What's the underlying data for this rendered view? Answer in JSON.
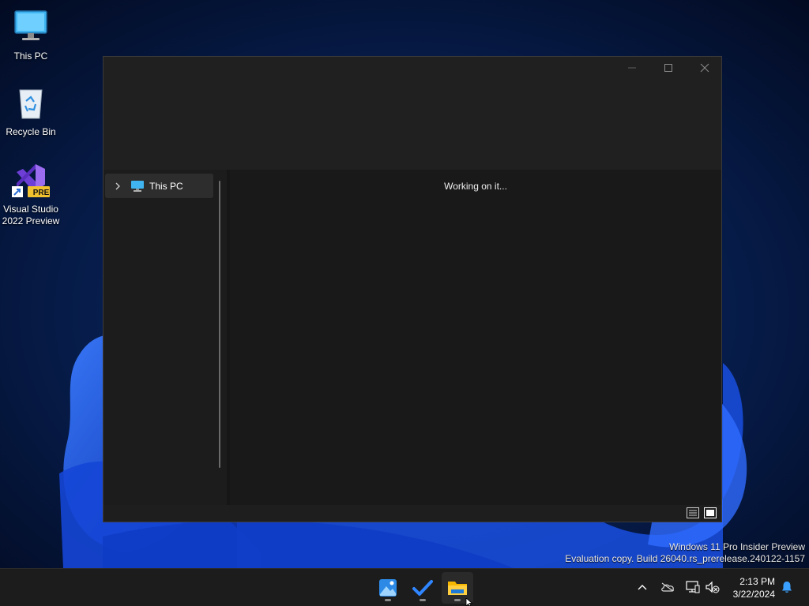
{
  "desktop": {
    "icons": [
      {
        "label": "This PC"
      },
      {
        "label": "Recycle Bin"
      },
      {
        "label_line1": "Visual Studio",
        "label_line2": "2022 Preview",
        "badge": "PRE"
      }
    ]
  },
  "explorer": {
    "nav": {
      "item_label": "This PC"
    },
    "content": {
      "status_text": "Working on it..."
    }
  },
  "watermark": {
    "line1": "Windows 11 Pro Insider Preview",
    "line2": "Evaluation copy. Build 26040.rs_prerelease.240122-1157"
  },
  "taskbar": {
    "apps": [
      {
        "icon": "photos-icon"
      },
      {
        "icon": "todo-icon"
      },
      {
        "icon": "file-explorer-icon",
        "active": true
      }
    ],
    "tray": {
      "icons": [
        "chevron-up-icon",
        "onedrive-offline-icon",
        "network-icon",
        "volume-muted-icon",
        "notifications-icon"
      ]
    },
    "clock": {
      "time": "2:13 PM",
      "date": "3/22/2024"
    }
  },
  "colors": {
    "accent": "#0a5bd6",
    "window_bg": "#1e1e1e",
    "taskbar_bg": "#1c1c1c"
  }
}
